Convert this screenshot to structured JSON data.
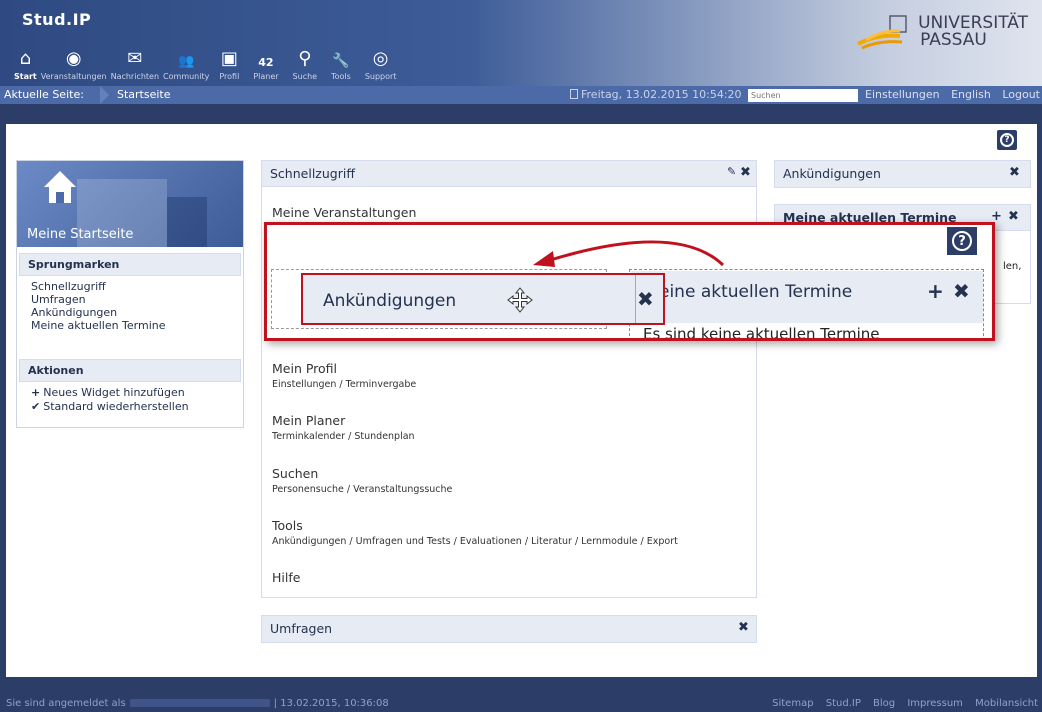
{
  "header": {
    "logo": "Stud.IP",
    "nav": [
      {
        "label": "Start",
        "icon": "home-icon",
        "glyph": "⌂"
      },
      {
        "label": "Veranstaltungen",
        "icon": "courses-icon",
        "glyph": "◉"
      },
      {
        "label": "Nachrichten",
        "icon": "mail-icon",
        "glyph": "✉"
      },
      {
        "label": "Community",
        "icon": "community-icon",
        "glyph": "👥"
      },
      {
        "label": "Profil",
        "icon": "profile-icon",
        "glyph": "▣"
      },
      {
        "label": "Planer",
        "icon": "calendar-icon",
        "glyph": "42"
      },
      {
        "label": "Suche",
        "icon": "search-icon",
        "glyph": "⚲"
      },
      {
        "label": "Tools",
        "icon": "wrench-icon",
        "glyph": "🔧"
      },
      {
        "label": "Support",
        "icon": "lifebuoy-icon",
        "glyph": "◎"
      }
    ],
    "university": [
      "UNIVERSITÄT",
      "PASSAU"
    ]
  },
  "crumbbar": {
    "label": "Aktuelle Seite:",
    "page": "Startseite",
    "clock": "Freitag, 13.02.2015 10:54:20",
    "search_placeholder": "Suchen",
    "links": [
      "Einstellungen",
      "English",
      "Logout"
    ]
  },
  "sidebar": {
    "title": "Meine Startseite",
    "jump_header": "Sprungmarken",
    "jump_links": [
      "Schnellzugriff",
      "Umfragen",
      "Ankündigungen",
      "Meine aktuellen Termine"
    ],
    "actions_header": "Aktionen",
    "actions": [
      {
        "icon": "plus-icon",
        "glyph": "+",
        "label": "Neues Widget hinzufügen"
      },
      {
        "icon": "check-icon",
        "glyph": "✔",
        "label": "Standard wiederherstellen"
      }
    ]
  },
  "quickaccess": {
    "title": "Schnellzugriff",
    "items": [
      {
        "title": "Meine Veranstaltungen",
        "sub": ""
      },
      {
        "title": "Mein Profil",
        "sub": "Einstellungen / Terminvergabe"
      },
      {
        "title": "Mein Planer",
        "sub": "Terminkalender / Stundenplan"
      },
      {
        "title": "Suchen",
        "sub": "Personensuche / Veranstaltungssuche"
      },
      {
        "title": "Tools",
        "sub": "Ankündigungen / Umfragen und Tests / Evaluationen / Literatur / Lernmodule / Export"
      },
      {
        "title": "Hilfe",
        "sub": ""
      }
    ]
  },
  "polls": {
    "title": "Umfragen"
  },
  "announcements": {
    "title": "Ankündigungen"
  },
  "dates": {
    "title": "Meine aktuellen Termine",
    "partial_text": "len,"
  },
  "zoom": {
    "drag_title": "Ankündigungen",
    "right_title": "eine aktuellen Termine",
    "right_text": "Es sind keine aktuellen Termine"
  },
  "footer": {
    "login_prefix": "Sie sind angemeldet als",
    "login_time": "| 13.02.2015, 10:36:08",
    "links": [
      "Sitemap",
      "Stud.IP",
      "Blog",
      "Impressum",
      "Mobilansicht"
    ]
  },
  "colors": {
    "accent": "#c0121e",
    "nav_dark": "#2c3e68",
    "widget_head": "#e7ebf4"
  }
}
